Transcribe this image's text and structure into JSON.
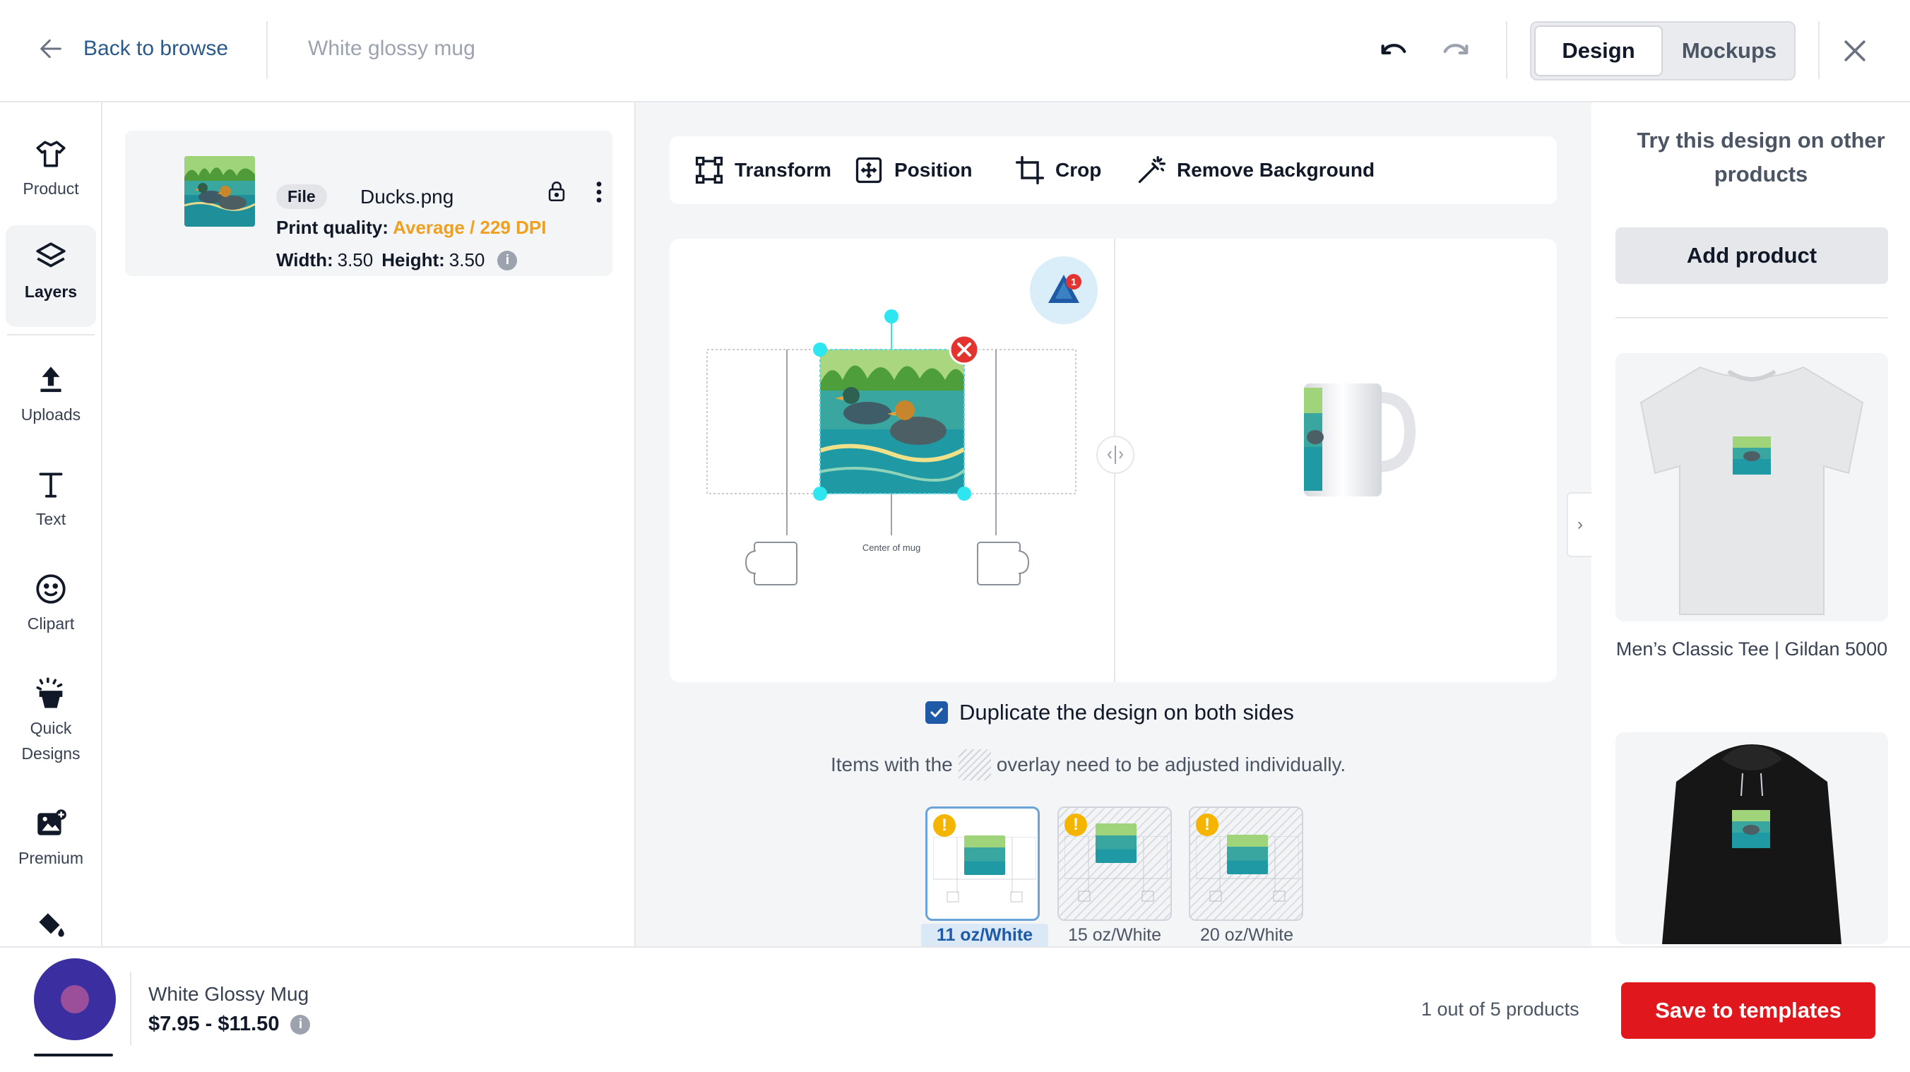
{
  "header": {
    "back_label": "Back to browse",
    "title": "White glossy mug",
    "mode_design": "Design",
    "mode_mockups": "Mockups"
  },
  "rail": {
    "items": [
      {
        "label": "Product",
        "icon": "shirt-icon"
      },
      {
        "label": "Layers",
        "icon": "layers-icon"
      },
      {
        "label": "Uploads",
        "icon": "upload-icon"
      },
      {
        "label": "Text",
        "icon": "text-icon"
      },
      {
        "label": "Clipart",
        "icon": "smiley-icon"
      },
      {
        "label": "Quick\nDesigns",
        "icon": "magic-icon"
      },
      {
        "label": "Premium",
        "icon": "premium-image-icon"
      },
      {
        "label": "",
        "icon": "paint-bucket-icon"
      }
    ],
    "quick_designs_line1": "Quick",
    "quick_designs_line2": "Designs"
  },
  "layer": {
    "file_badge": "File",
    "file_name": "Ducks.png",
    "quality_label": "Print quality:",
    "quality_value": "Average / 229 DPI",
    "width_label": "Width:",
    "width_value": "3.50",
    "height_label": "Height:",
    "height_value": "3.50"
  },
  "toolbar": {
    "transform": "Transform",
    "position": "Position",
    "crop": "Crop",
    "remove_bg": "Remove Background"
  },
  "canvas": {
    "center_label": "Center of mug",
    "warning_count": "1"
  },
  "options": {
    "duplicate_label": "Duplicate the design on both sides",
    "duplicate_checked": true,
    "overlay_before": "Items with the",
    "overlay_after": "overlay need to be adjusted individually."
  },
  "variants": [
    {
      "label": "11 oz/White",
      "selected": true
    },
    {
      "label": "15 oz/White",
      "selected": false
    },
    {
      "label": "20 oz/White",
      "selected": false
    }
  ],
  "right_panel": {
    "title": "Try this design on other products",
    "add_product": "Add product",
    "products": [
      {
        "label": "Men’s Classic Tee | Gildan 5000"
      }
    ]
  },
  "bottom": {
    "product_name": "White Glossy Mug",
    "price": "$7.95 - $11.50",
    "count": "1 out of 5 products",
    "save_label": "Save to templates"
  },
  "colors": {
    "accent_blue": "#1f5aa6",
    "save_red": "#e0181e",
    "quality_orange": "#f0a020",
    "handle_cyan": "#2ee6f0"
  }
}
